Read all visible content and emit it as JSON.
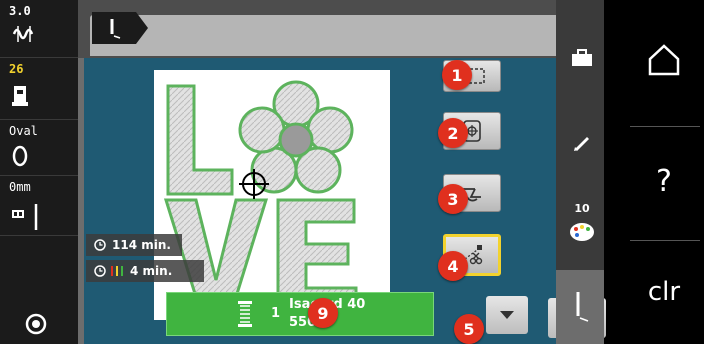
{
  "status": {
    "stitch_width": "3.0",
    "stitch_length": "26",
    "hoop_name": "Oval",
    "needle_position": "0mm"
  },
  "info": {
    "total_time": "114 min.",
    "color_time": "4 min."
  },
  "color_bar": {
    "index": "1",
    "thread_name": "Isacord 40",
    "thread_code": "5500"
  },
  "badges": {
    "b1": "1",
    "b2": "2",
    "b3": "3",
    "b4": "4",
    "b5": "5",
    "b9": "9"
  },
  "right_tabs": {
    "color_count": "10"
  },
  "far_right": {
    "clr_label": "clr",
    "help_label": "?"
  },
  "colors": {
    "accent_yellow": "#f2d22e",
    "thread_green": "#40b440",
    "badge_red": "#e0301e",
    "canvas_blue": "#1f5a73"
  }
}
